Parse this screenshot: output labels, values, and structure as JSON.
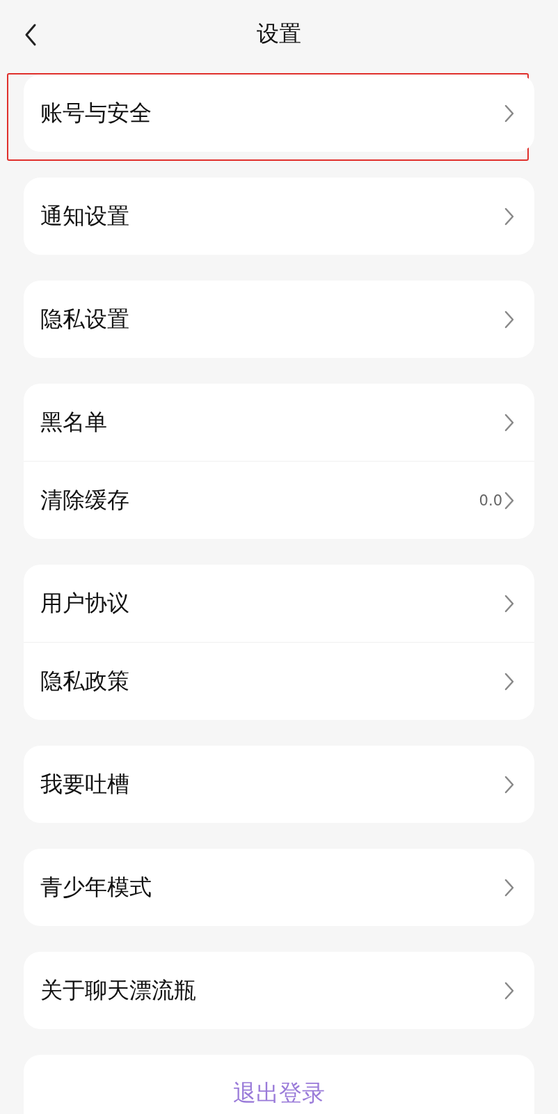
{
  "header": {
    "title": "设置"
  },
  "groups": [
    {
      "highlighted": true,
      "items": [
        {
          "label": "账号与安全"
        }
      ]
    },
    {
      "highlighted": false,
      "items": [
        {
          "label": "通知设置"
        }
      ]
    },
    {
      "highlighted": false,
      "items": [
        {
          "label": "隐私设置"
        }
      ]
    },
    {
      "highlighted": false,
      "items": [
        {
          "label": "黑名单"
        },
        {
          "label": "清除缓存",
          "value": "0.0"
        }
      ]
    },
    {
      "highlighted": false,
      "items": [
        {
          "label": "用户协议"
        },
        {
          "label": "隐私政策"
        }
      ]
    },
    {
      "highlighted": false,
      "items": [
        {
          "label": "我要吐槽"
        }
      ]
    },
    {
      "highlighted": false,
      "items": [
        {
          "label": "青少年模式"
        }
      ]
    },
    {
      "highlighted": false,
      "items": [
        {
          "label": "关于聊天漂流瓶"
        }
      ]
    }
  ],
  "logout": {
    "label": "退出登录"
  }
}
